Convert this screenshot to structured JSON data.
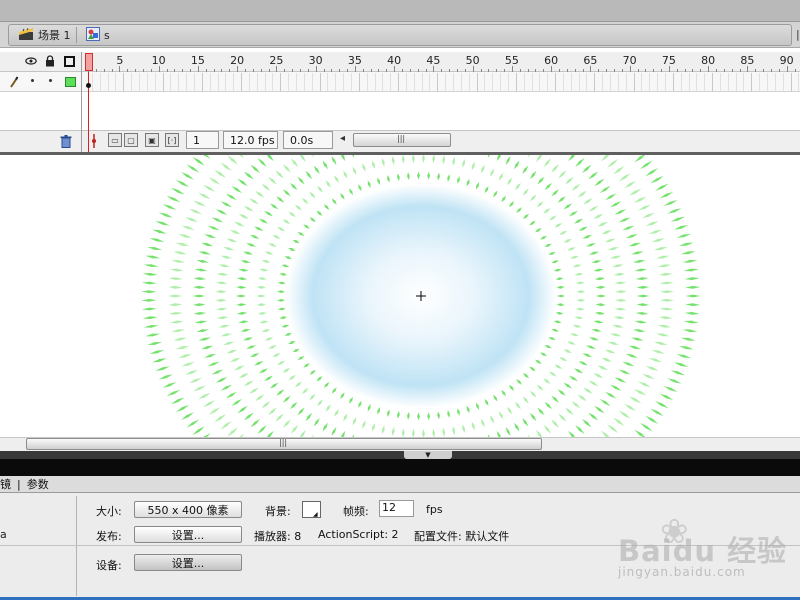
{
  "breadcrumb": {
    "scene_label": "场景 1",
    "symbol_label": "s"
  },
  "timeline": {
    "ruler_numbers": [
      "5",
      "10",
      "15",
      "20",
      "25",
      "30",
      "35",
      "40",
      "45",
      "50",
      "55",
      "60",
      "65",
      "70",
      "75",
      "80",
      "85",
      "90"
    ],
    "current_frame": "1",
    "frame_rate": "12.0 fps",
    "elapsed_time": "0.0s",
    "layer_color": "#5ce05c"
  },
  "stage": {
    "ring_color": "#6fe066",
    "glow_color": "#bfe3f5"
  },
  "properties": {
    "tab_partial": "镜",
    "tab_separator": "|",
    "tab_params": "参数",
    "left_label_partial": "a",
    "size_label": "大小:",
    "size_button": "550 x 400 像素",
    "background_label": "背景:",
    "background_color": "#ffffff",
    "frame_rate_label": "帧频:",
    "frame_rate_value": "12",
    "fps_unit": "fps",
    "publish_label": "发布:",
    "publish_settings_button": "设置...",
    "player_text": "播放器: 8",
    "actionscript_text": "ActionScript: 2",
    "profile_text": "配置文件: 默认文件",
    "device_label": "设备:",
    "device_settings_button": "设置..."
  },
  "watermark": {
    "brand": "Baidu 经验",
    "url": "jingyan.baidu.com"
  }
}
